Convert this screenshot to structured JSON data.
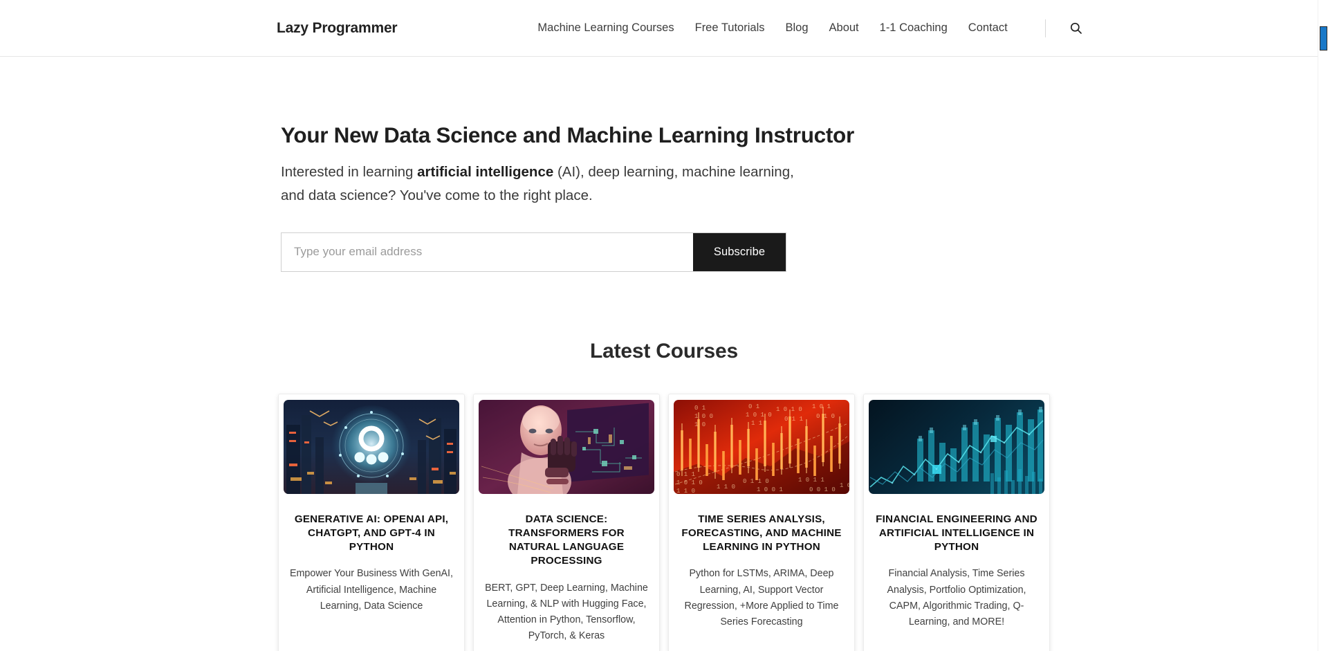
{
  "header": {
    "brand": "Lazy Programmer",
    "nav": [
      {
        "label": "Machine Learning Courses"
      },
      {
        "label": "Free Tutorials"
      },
      {
        "label": "Blog"
      },
      {
        "label": "About"
      },
      {
        "label": "1-1 Coaching"
      },
      {
        "label": "Contact"
      }
    ],
    "search_icon": "search-icon"
  },
  "hero": {
    "title": "Your New Data Science and Machine Learning Instructor",
    "sub_before": "Interested in learning ",
    "sub_bold": "artificial intelligence",
    "sub_after": " (AI), deep learning, machine learning, and data science? You've come to the right place.",
    "email_placeholder": "Type your email address",
    "email_value": "",
    "subscribe_label": "Subscribe"
  },
  "courses_section": {
    "title": "Latest Courses",
    "cards": [
      {
        "title": "Generative AI: OpenAI API, ChatGPT, and GPT‑4 in Python",
        "desc": "Empower Your Business With GenAI, Artificial Intelligence, Machine Learning, Data Science",
        "thumb": "cyberpunk-city-ai-logo-thumbnail"
      },
      {
        "title": "Data Science: Transformers for Natural Language Processing",
        "desc": "BERT, GPT, Deep Learning, Machine Learning, & NLP with Hugging Face, Attention in Python, Tensorflow, PyTorch, & Keras",
        "thumb": "humanoid-robot-circuit-board-thumbnail"
      },
      {
        "title": "Time Series Analysis, Forecasting, and Machine Learning in Python",
        "desc": "Python for LSTMs, ARIMA, Deep Learning, AI, Support Vector Regression, +More Applied to Time Series Forecasting",
        "thumb": "red-candlestick-chart-thumbnail"
      },
      {
        "title": "Financial Engineering and Artificial Intelligence in Python",
        "desc": "Financial Analysis, Time Series Analysis, Portfolio Optimization, CAPM, Algorithmic Trading, Q-Learning, and MORE!",
        "thumb": "teal-financial-chart-thumbnail"
      }
    ]
  },
  "scrollbar": {
    "thumb_color": "#1878c8"
  }
}
